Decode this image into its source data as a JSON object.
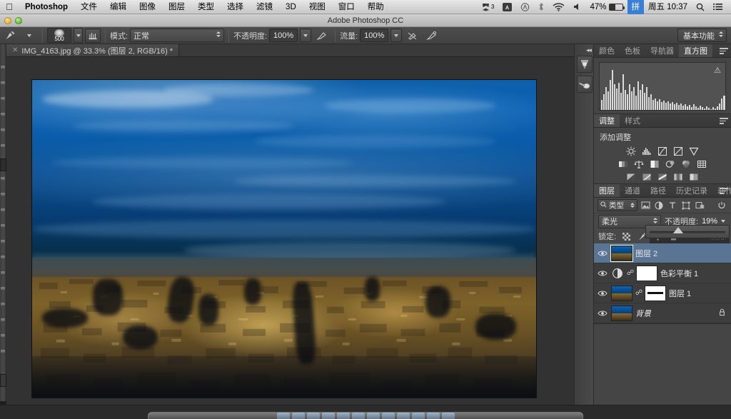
{
  "os_menubar": {
    "apple_icon": "apple-logo",
    "items": [
      {
        "label": "Photoshop",
        "bold": true
      },
      {
        "label": "文件"
      },
      {
        "label": "编辑"
      },
      {
        "label": "图像"
      },
      {
        "label": "图层"
      },
      {
        "label": "类型"
      },
      {
        "label": "选择"
      },
      {
        "label": "滤镜"
      },
      {
        "label": "3D"
      },
      {
        "label": "视图"
      },
      {
        "label": "窗口"
      },
      {
        "label": "帮助"
      }
    ],
    "status": {
      "notification_badge": "3",
      "battery_percent": "47%",
      "input_method": "拼",
      "clock": "周五 10:37",
      "icons": [
        "dropbox-icon",
        "adobe-creative-cloud-icon",
        "circle-a-icon",
        "bluetooth-icon",
        "wifi-icon",
        "volume-icon",
        "battery-icon",
        "ime-icon",
        "spotlight-search-icon",
        "notification-center-icon"
      ]
    }
  },
  "titlebar": {
    "title": "Adobe Photoshop CC",
    "buttons": [
      "minimize-button",
      "zoom-button"
    ]
  },
  "options_bar": {
    "tool_icon": "brush-tool-icon",
    "tool_preset_caret": "chevron-down-icon",
    "brush_size": "500",
    "brush_panel_toggle": "brush-panel-toggle-icon",
    "mode_label": "模式:",
    "mode_value": "正常",
    "opacity_label": "不透明度:",
    "opacity_value": "100%",
    "opacity_pressure_icon": "pressure-opacity-icon",
    "flow_label": "流量:",
    "flow_value": "100%",
    "airbrush_icon": "airbrush-icon",
    "pressure_size_icon": "pressure-size-icon",
    "workspace": "基本功能"
  },
  "document_tab": {
    "close_icon": "close-icon",
    "title": "IMG_4163.jpg @ 33.3% (图层 2, RGB/16) *"
  },
  "dock_strip": {
    "collapse_icon": "collapse-panels-icon",
    "buttons": [
      "history-brush-panel-icon",
      "clone-source-panel-icon"
    ]
  },
  "histogram_panel": {
    "tabs": [
      {
        "label": "颜色",
        "active": false
      },
      {
        "label": "色板",
        "active": false
      },
      {
        "label": "导航器",
        "active": false
      },
      {
        "label": "直方图",
        "active": true
      }
    ],
    "warning_icon": "cached-data-warning-icon",
    "menu_icon": "panel-menu-icon"
  },
  "adjustments_panel": {
    "tabs": [
      {
        "label": "调整",
        "active": true
      },
      {
        "label": "样式",
        "active": false
      }
    ],
    "heading": "添加调整",
    "menu_icon": "panel-menu-icon",
    "rows": [
      [
        "brightness-contrast-icon",
        "levels-icon",
        "curves-icon",
        "exposure-icon",
        "vibrance-icon"
      ],
      [
        "hue-saturation-icon",
        "color-balance-icon",
        "black-white-icon",
        "photo-filter-icon",
        "channel-mixer-icon",
        "color-lookup-icon"
      ],
      [
        "invert-icon",
        "posterize-icon",
        "threshold-icon",
        "gradient-map-icon",
        "selective-color-icon"
      ]
    ]
  },
  "layers_panel": {
    "tabs": [
      {
        "label": "图层",
        "active": true
      },
      {
        "label": "通道",
        "active": false
      },
      {
        "label": "路径",
        "active": false
      },
      {
        "label": "历史记录",
        "active": false
      },
      {
        "label": "动作",
        "active": false
      }
    ],
    "menu_icon": "panel-menu-icon",
    "filter": {
      "search_icon": "search-icon",
      "kind_label": "类型",
      "icons": [
        "filter-pixel-icon",
        "filter-adjustment-icon",
        "filter-type-icon",
        "filter-shape-icon",
        "filter-smart-object-icon"
      ],
      "power_icon": "filter-toggle-icon"
    },
    "blend_mode": "柔光",
    "opacity_label": "不透明度:",
    "opacity_value": "19%",
    "lock_label": "锁定:",
    "lock_icons": [
      "lock-transparency-icon",
      "lock-image-icon",
      "lock-position-icon",
      "lock-all-icon"
    ],
    "fill_label": "填充:",
    "layers": [
      {
        "name": "图层 2",
        "visible": true,
        "selected": true,
        "thumb": "photo",
        "mask": null,
        "locked": false,
        "italic": false
      },
      {
        "name": "色彩平衡 1",
        "visible": true,
        "selected": false,
        "thumb": "adjustment",
        "mask": "white",
        "locked": false,
        "italic": false
      },
      {
        "name": "图层 1",
        "visible": true,
        "selected": false,
        "thumb": "photo",
        "mask": "black-white",
        "locked": false,
        "italic": false
      },
      {
        "name": "背景",
        "visible": true,
        "selected": false,
        "thumb": "photo",
        "mask": null,
        "locked": true,
        "italic": true
      }
    ],
    "footer_icons": [
      "link-layers-icon",
      "layer-style-icon",
      "add-mask-icon",
      "new-adjustment-icon",
      "new-group-icon",
      "new-layer-icon",
      "delete-layer-icon"
    ]
  },
  "canvas": {
    "image_name": "paris-night-cityscape-photo",
    "zoom": "33.3%"
  },
  "colors": {
    "accent_selected_layer": "#5a7494",
    "panel_bg": "#454545",
    "canvas_bg": "#323232",
    "sky_blue": "#0c63b4",
    "city_gold": "#7d6229"
  }
}
